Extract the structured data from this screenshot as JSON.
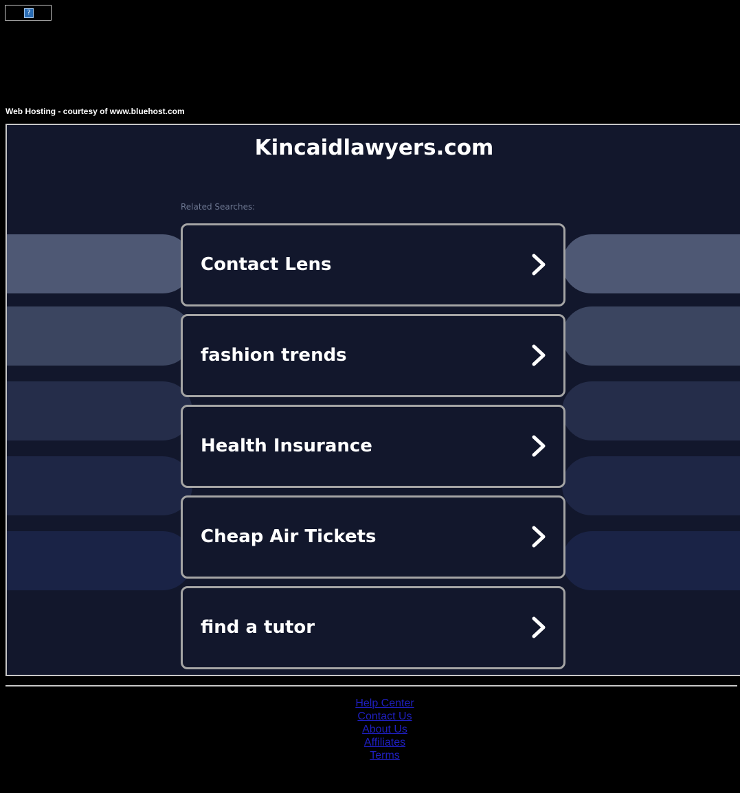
{
  "ad_placeholder": {
    "icon": "broken-image-icon",
    "glyph": "?"
  },
  "courtesy_text": "Web Hosting - courtesy of www.bluehost.com",
  "domain_title": "Kincaidlawyers.com",
  "related_label": "Related Searches:",
  "searches": [
    {
      "label": "Contact Lens"
    },
    {
      "label": "fashion trends"
    },
    {
      "label": "Health Insurance"
    },
    {
      "label": "Cheap Air Tickets"
    },
    {
      "label": "find a tutor"
    }
  ],
  "footer_links": [
    "Help Center",
    "Contact Us",
    "About Us",
    "Affiliates",
    "Terms"
  ],
  "colors": {
    "page_bg": "#000000",
    "panel_bg": "#12172c",
    "button_border": "#a5a5a5",
    "pill_shades": [
      "#4e5874",
      "#3b4560",
      "#252d4a",
      "#1e2645",
      "#1a2346"
    ],
    "link": "#1f1fbf"
  }
}
